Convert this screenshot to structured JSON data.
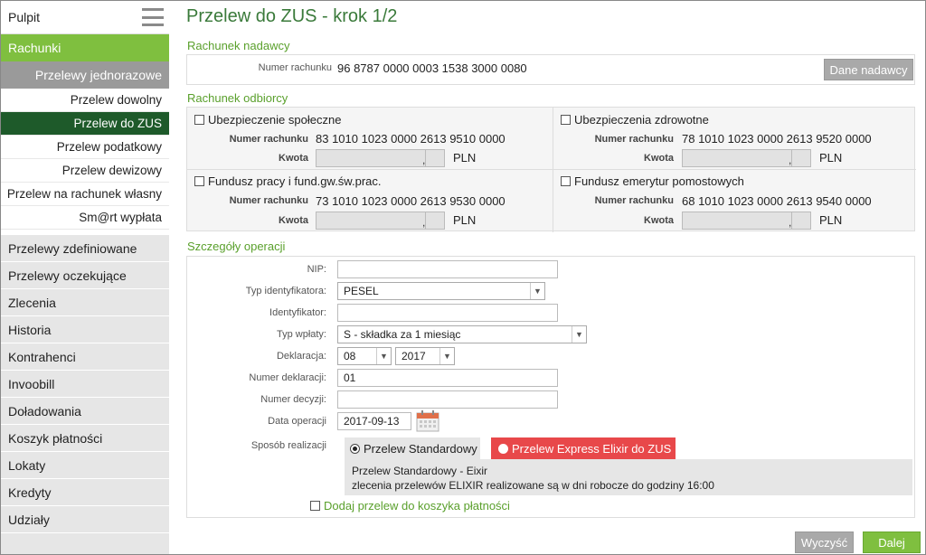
{
  "sidebar": {
    "top_label": "Pulpit",
    "active": "Rachunki",
    "sub_header": "Przelewy jednorazowe",
    "sub_items": [
      "Przelew dowolny",
      "Przelew do ZUS",
      "Przelew podatkowy",
      "Przelew dewizowy",
      "Przelew na rachunek własny",
      "Sm@rt wypłata"
    ],
    "items": [
      "Przelewy zdefiniowane",
      "Przelewy oczekujące",
      "Zlecenia",
      "Historia",
      "Kontrahenci",
      "Invoobill",
      "Doładowania",
      "Koszyk płatności",
      "Lokaty",
      "Kredyty",
      "Udziały"
    ]
  },
  "page": {
    "title": "Przelew do ZUS - krok 1/2"
  },
  "sender": {
    "section": "Rachunek nadawcy",
    "account_label": "Numer rachunku",
    "account_number": "96 8787 0000 0003 1538 3000 0080",
    "button": "Dane nadawcy"
  },
  "recipient": {
    "section": "Rachunek odbiorcy",
    "account_label": "Numer rachunku",
    "amount_label": "Kwota",
    "comma": ",",
    "currency": "PLN",
    "funds": [
      {
        "name": "Ubezpieczenie społeczne",
        "account": "83 1010 1023 0000 2613 9510 0000"
      },
      {
        "name": "Ubezpieczenia zdrowotne",
        "account": "78 1010 1023 0000 2613 9520 0000"
      },
      {
        "name": "Fundusz pracy i fund.gw.św.prac.",
        "account": "73 1010 1023 0000 2613 9530 0000"
      },
      {
        "name": "Fundusz emerytur pomostowych",
        "account": "68 1010 1023 0000 2613 9540 0000"
      }
    ]
  },
  "details": {
    "section": "Szczegóły operacji",
    "nip_label": "NIP:",
    "id_type_label": "Typ identyfikatora:",
    "id_type_value": "PESEL",
    "identifier_label": "Identyfikator:",
    "payment_type_label": "Typ wpłaty:",
    "payment_type_value": "S - składka za 1 miesiąc",
    "declaration_label": "Deklaracja:",
    "declaration_month": "08",
    "declaration_year": "2017",
    "declaration_number_label": "Numer deklaracji:",
    "declaration_number_value": "01",
    "decision_number_label": "Numer decyzji:",
    "operation_date_label": "Data operacji",
    "operation_date_value": "2017-09-13",
    "method_label": "Sposób realizacji",
    "method_standard": "Przelew Standardowy",
    "method_express": "Przelew Express Elixir do ZUS",
    "method_info_title": "Przelew Standardowy - Eixir",
    "method_info_text": "zlecenia przelewów ELIXIR realizowane są w dni robocze do godziny 16:00",
    "basket_label": "Dodaj przelew do koszyka płatności"
  },
  "actions": {
    "clear": "Wyczyść",
    "next": "Dalej"
  },
  "colors": {
    "green_accent": "#7fbf3f",
    "dark_green": "#1e5a2a",
    "express_red": "#e8484a"
  }
}
